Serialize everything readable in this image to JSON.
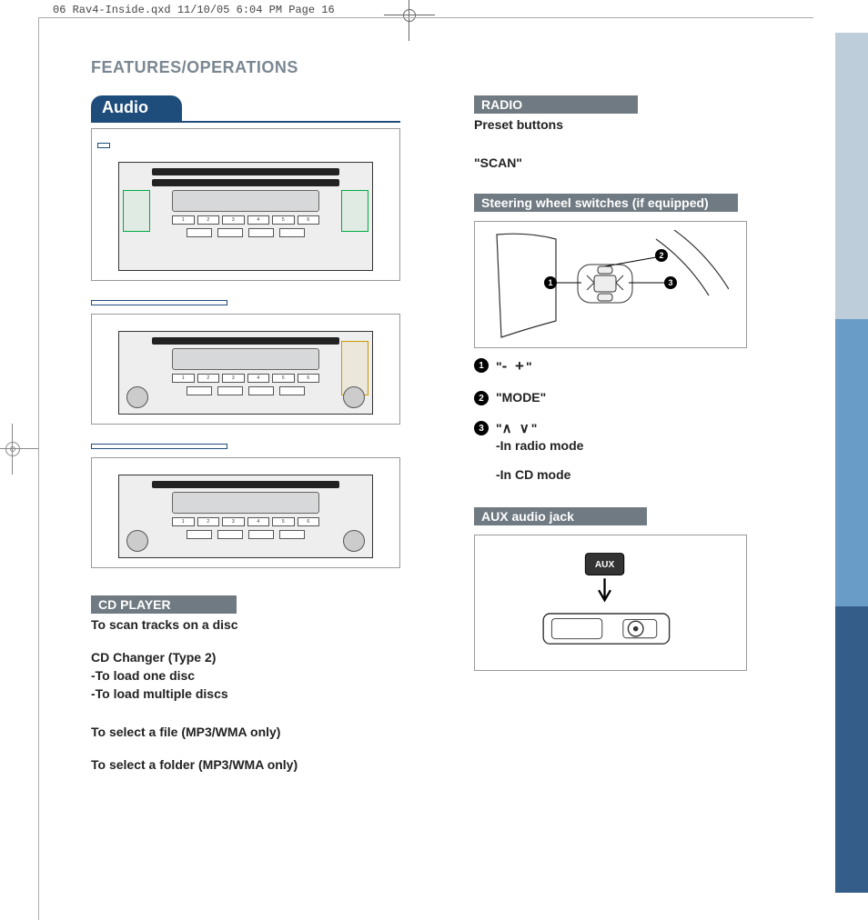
{
  "print_header": "06 Rav4-Inside.qxd  11/10/05  6:04 PM  Page 16",
  "section_title": "FEATURES/OPERATIONS",
  "audio_heading": "Audio",
  "type_labels": {
    "t1": "",
    "t2": "",
    "t3": ""
  },
  "cd_player": {
    "heading": "CD PLAYER",
    "scan_tracks": "To scan tracks on a disc",
    "cd_changer": "CD Changer (Type 2)",
    "load_one": "-To load one disc",
    "load_multi": "-To load multiple discs",
    "select_file": "To select a file (MP3/WMA only)",
    "select_folder": "To select a folder (MP3/WMA only)"
  },
  "radio": {
    "heading": "RADIO",
    "preset": "Preset buttons",
    "scan": "\"SCAN\""
  },
  "steering": {
    "heading": "Steering wheel switches (if equipped)",
    "items": [
      {
        "n": "1",
        "sym": "\"- +\""
      },
      {
        "n": "2",
        "sym": "\"MODE\""
      },
      {
        "n": "3",
        "sym": "\"     \"",
        "up_down_glyph": "∧ ∨",
        "sub1": "-In radio mode",
        "sub2": "-In CD mode"
      }
    ]
  },
  "aux": {
    "heading": "AUX audio jack",
    "label": "AUX"
  },
  "radio_buttons": {
    "b1": "1",
    "b2": "2",
    "b3": "3",
    "b4": "4",
    "b5": "5",
    "b6": "6"
  }
}
